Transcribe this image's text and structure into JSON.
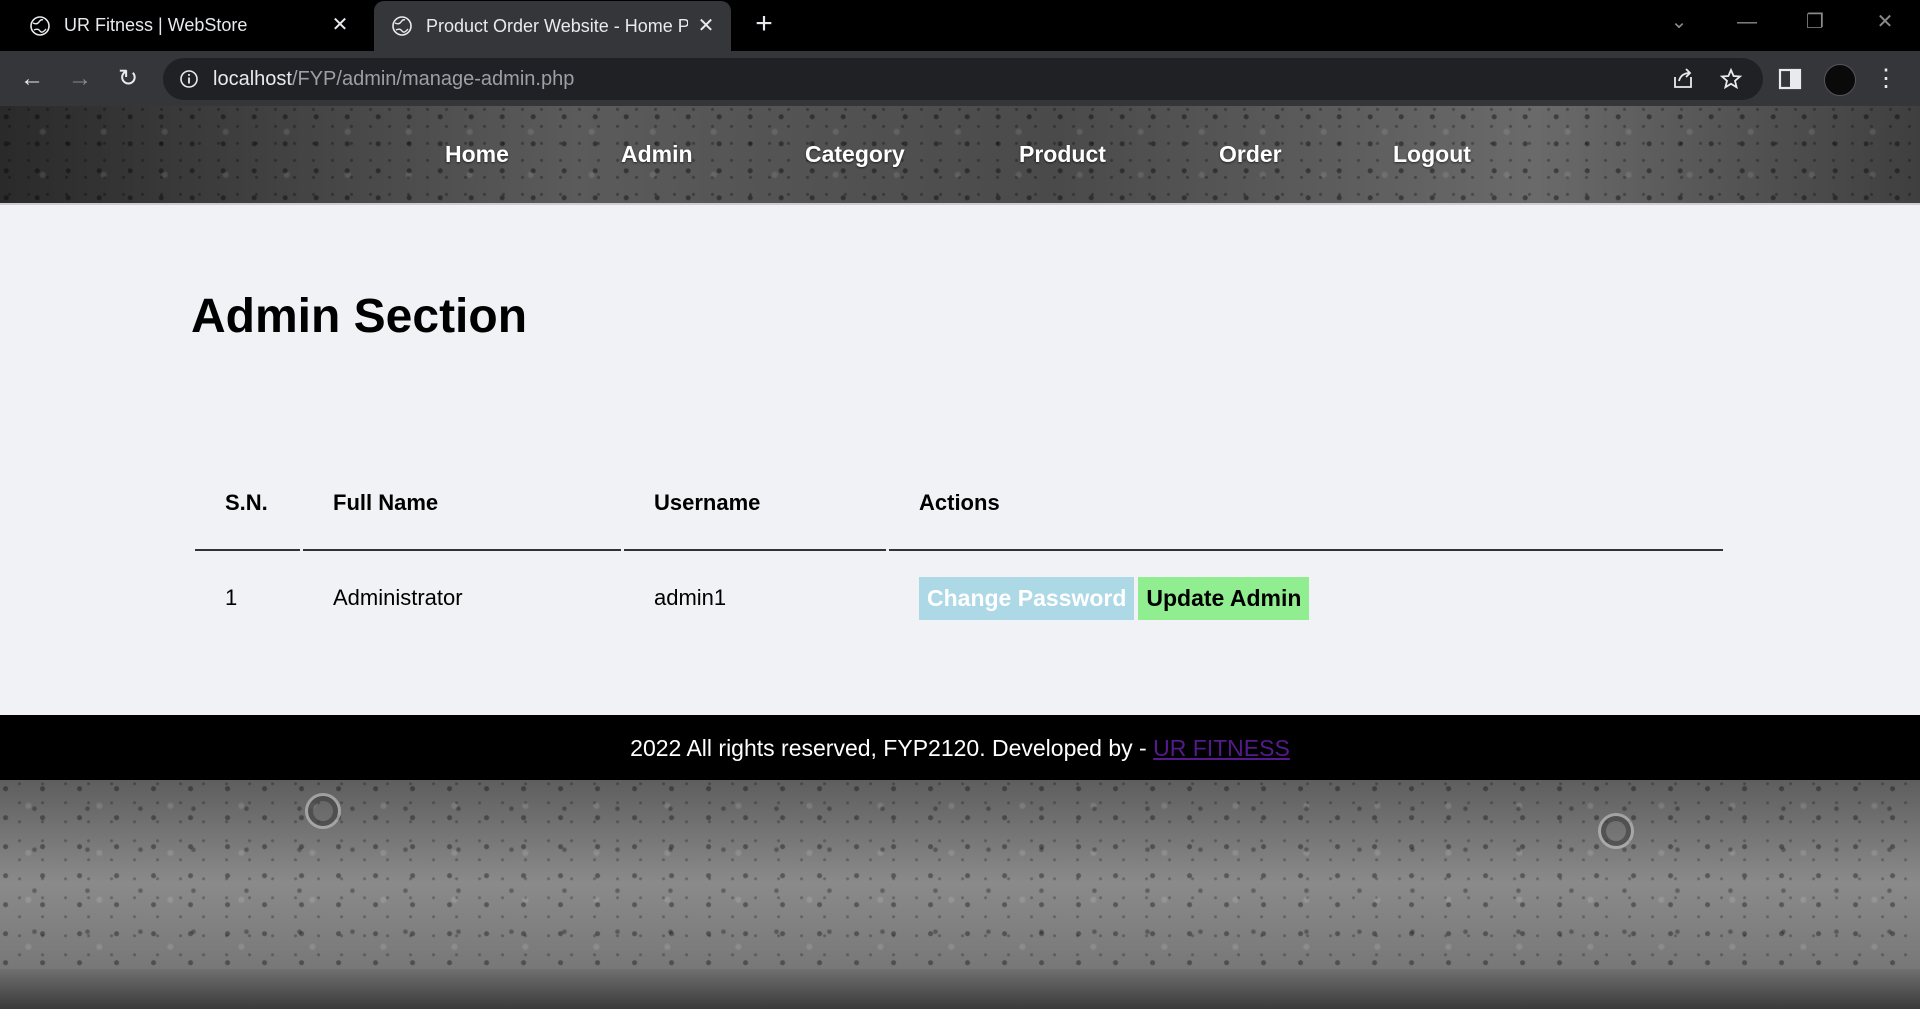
{
  "browser": {
    "tabs": [
      {
        "title": "UR Fitness | WebStore",
        "active": false
      },
      {
        "title": "Product Order Website - Home P",
        "active": true
      }
    ],
    "url_host": "localhost",
    "url_path": "/FYP/admin/manage-admin.php"
  },
  "menu": {
    "items": [
      "Home",
      "Admin",
      "Category",
      "Product",
      "Order",
      "Logout"
    ]
  },
  "main": {
    "heading": "Admin Section",
    "table": {
      "headers": [
        "S.N.",
        "Full Name",
        "Username",
        "Actions"
      ],
      "rows": [
        {
          "sn": "1",
          "full_name": "Administrator",
          "username": "admin1",
          "actions": [
            "Change Password",
            "Update Admin"
          ]
        }
      ]
    }
  },
  "footer": {
    "text": "2022 All rights reserved, FYP2120. Developed by - ",
    "link_text": "UR FITNESS"
  },
  "colors": {
    "change_password_bg": "#add8e6",
    "update_admin_bg": "#90ee90",
    "content_bg": "#f1f2f6",
    "footer_bg": "#000000",
    "link": "#551a8b"
  }
}
